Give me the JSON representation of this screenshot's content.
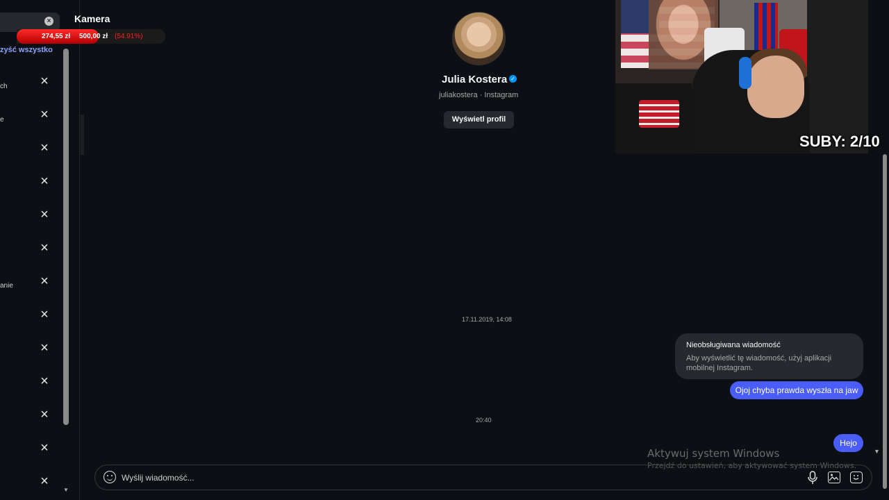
{
  "sidebar": {
    "clear_all_label": "zyść wszystko",
    "recent_items": [
      {
        "label": "ch"
      },
      {
        "label": "e"
      },
      {
        "label": ""
      },
      {
        "label": ""
      },
      {
        "label": ""
      },
      {
        "label": ""
      },
      {
        "label": "anie"
      },
      {
        "label": ""
      },
      {
        "label": ""
      },
      {
        "label": ""
      },
      {
        "label": ""
      },
      {
        "label": ""
      },
      {
        "label": ""
      }
    ],
    "remove_icon": "close-icon"
  },
  "overlay": {
    "title": "Kamera",
    "goal_current": "274,55 zł",
    "goal_target": "500,00 zł",
    "goal_percent": "(54.91%)",
    "goal_progress": 0.5491,
    "goal_color": "#ff2020"
  },
  "chat": {
    "profile_name": "Julia Kostera",
    "verified": true,
    "profile_sub": "juliakostera · Instagram",
    "view_profile_label": "Wyświetl profil",
    "messages": [
      {
        "type": "timestamp",
        "text": "17.11.2019, 14:08"
      },
      {
        "type": "unsupported",
        "title": "Nieobsługiwana wiadomość",
        "body": "Aby wyświetlić tę wiadomość, użyj aplikacji mobilnej Instagram."
      },
      {
        "type": "sent",
        "text": "Ojoj chyba prawda wyszła na jaw"
      },
      {
        "type": "timestamp",
        "text": "20:40"
      },
      {
        "type": "sent",
        "text": "Hejo"
      }
    ],
    "accent_color": "#4a5df9"
  },
  "webcam": {
    "subs_label": "SUBY: 2/10"
  },
  "windows_watermark": {
    "title": "Aktywuj system Windows",
    "subtitle": "Przejdź do ustawień, aby aktywować system Windows."
  },
  "composer": {
    "placeholder": "Wyślij wiadomość...",
    "icons": [
      "emoji-icon",
      "microphone-icon",
      "image-icon",
      "sticker-icon"
    ]
  }
}
